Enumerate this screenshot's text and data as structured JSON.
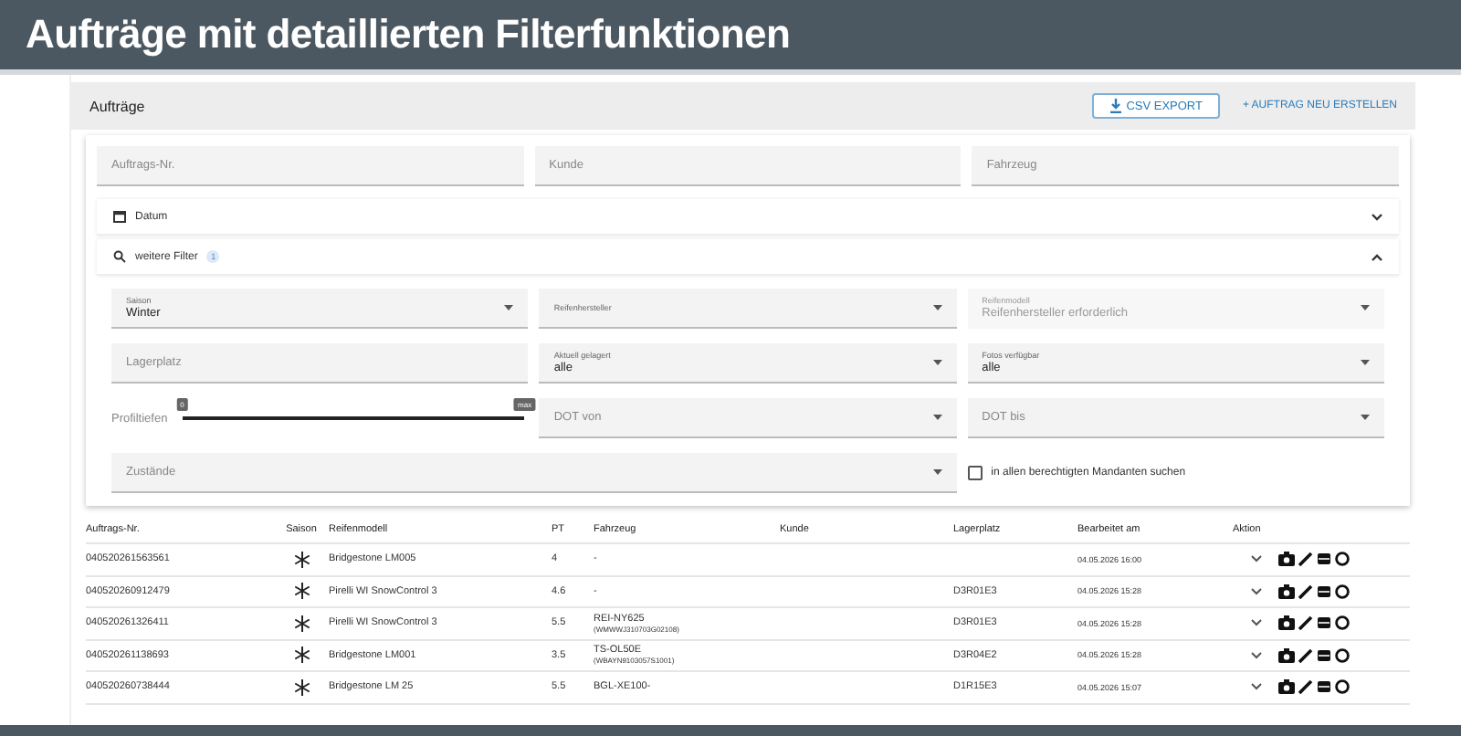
{
  "banner": {
    "title": "Aufträge mit detaillierten Filterfunktionen"
  },
  "toolbar": {
    "title": "Aufträge",
    "export_button": "CSV EXPORT",
    "create_button": "+ AUFTRAG NEU ERSTELLEN"
  },
  "search_fields": [
    {
      "placeholder": "Auftrags-Nr."
    },
    {
      "placeholder": "Kunde"
    },
    {
      "placeholder": "Fahrzeug"
    }
  ],
  "panels": [
    {
      "title": "Datum",
      "kind": "date",
      "expanded": false
    },
    {
      "title": "weitere Filter",
      "kind": "search",
      "expanded": true,
      "badge": "1"
    }
  ],
  "filters": [
    {
      "kind": "select",
      "label": "Saison",
      "value": "Winter",
      "disabled": false
    },
    {
      "kind": "select",
      "label": "Reifenhersteller",
      "disabled": false
    },
    {
      "kind": "select",
      "label": "Reifenmodell",
      "value": "Reifenhersteller erforderlich",
      "disabled": true
    },
    {
      "kind": "text",
      "placeholder": "Lagerplatz"
    },
    {
      "kind": "select",
      "label": "Aktuell gelagert",
      "value": "alle",
      "disabled": false
    },
    {
      "kind": "select",
      "label": "Fotos verfügbar",
      "value": "alle",
      "disabled": false
    },
    {
      "kind": "slider",
      "label": "Profiltiefen",
      "min_label": "0",
      "max_label": "max",
      "level": 1
    },
    {
      "kind": "select",
      "placeholder": "DOT von",
      "disabled": false
    },
    {
      "kind": "select",
      "placeholder": "DOT bis",
      "disabled": false
    },
    {
      "kind": "select",
      "placeholder": "Zustände",
      "disabled": false,
      "wide": true
    },
    {
      "kind": "checkbox",
      "label": "in allen berechtigten Mandanten suchen",
      "checked": false
    }
  ],
  "table": {
    "columns": [
      "Auftrags-Nr.",
      "Saison",
      "Reifenmodell",
      "PT",
      "Fahrzeug",
      "Kunde",
      "Lagerplatz",
      "Bearbeitet am",
      "Aktion"
    ],
    "rows": [
      {
        "order_no": "040520261563561",
        "model": "Bridgestone LM005",
        "pt": "4",
        "vehicle": "-",
        "location": "",
        "edited": "04.05.2026 16:00"
      },
      {
        "order_no": "040520260912479",
        "model": "Pirelli WI SnowControl 3",
        "pt": "4.6",
        "vehicle": "-",
        "location": "D3R01E3",
        "edited": "04.05.2026 15:28"
      },
      {
        "order_no": "040520261326411",
        "model": "Pirelli WI SnowControl 3",
        "pt": "5.5",
        "vehicle": "REI-NY625",
        "vin": "(WMWWJ310703G02108)",
        "location": "D3R01E3",
        "edited": "04.05.2026 15:28"
      },
      {
        "order_no": "040520261138693",
        "model": "Bridgestone LM001",
        "pt": "3.5",
        "vehicle": "TS-OL50E",
        "vin": "(WBAYN9103057S1001)",
        "location": "D3R04E2",
        "edited": "04.05.2026 15:28"
      },
      {
        "order_no": "040520260738444",
        "model": "Bridgestone LM 25",
        "pt": "5.5",
        "vehicle": "BGL-XE100-",
        "location": "D1R15E3",
        "edited": "04.05.2026 15:07"
      }
    ]
  }
}
